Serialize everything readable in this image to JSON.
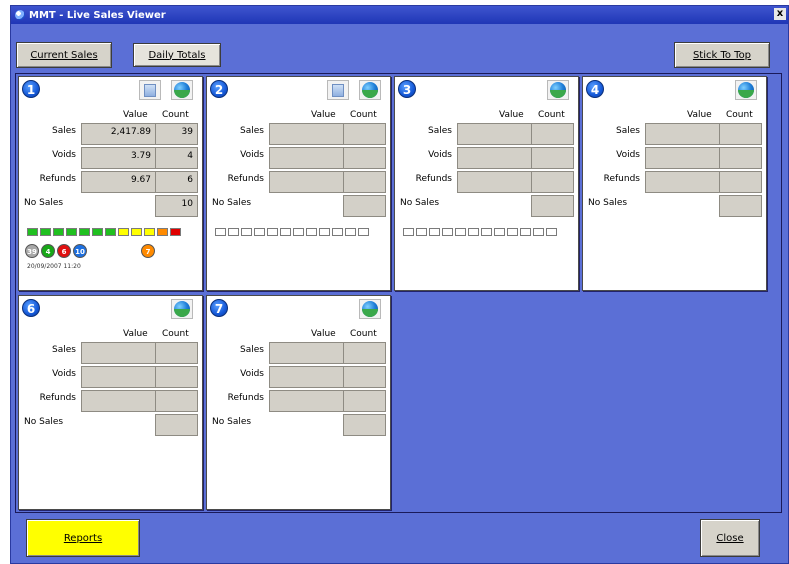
{
  "window": {
    "title": "MMT - Live Sales Viewer",
    "close_glyph": "x"
  },
  "toolbar": {
    "current_sales": "Current Sales",
    "daily_totals": "Daily Totals",
    "stick_to_top": "Stick To Top"
  },
  "footer": {
    "reports": "Reports",
    "close": "Close"
  },
  "table_headers": {
    "value": "Value",
    "count": "Count"
  },
  "row_labels": {
    "sales": "Sales",
    "voids": "Voids",
    "refunds": "Refunds",
    "no_sales": "No Sales"
  },
  "panels": [
    {
      "number": "1",
      "sales_value": "2,417.89",
      "sales_count": "39",
      "voids_value": "3.79",
      "voids_count": "4",
      "refunds_value": "9.67",
      "refunds_count": "6",
      "no_sales_count": "10",
      "has_doc_icon": true
    },
    {
      "number": "2",
      "has_doc_icon": true
    },
    {
      "number": "3",
      "has_doc_icon": false
    },
    {
      "number": "4",
      "has_doc_icon": false
    },
    {
      "number": "6",
      "has_doc_icon": false
    },
    {
      "number": "7",
      "has_doc_icon": false
    }
  ],
  "panel1_status": {
    "led_colors": [
      "#20c020",
      "#20c020",
      "#20c020",
      "#20c020",
      "#20c020",
      "#20c020",
      "#20c020",
      "#ffff00",
      "#ffff00",
      "#ffff00",
      "#ff8a00",
      "#e00000"
    ],
    "circles": [
      {
        "label": "39",
        "color": "#a8a8a8"
      },
      {
        "label": "4",
        "color": "#18a818"
      },
      {
        "label": "6",
        "color": "#e01010"
      },
      {
        "label": "10",
        "color": "#1e70e0"
      },
      {
        "label": "7",
        "color": "#ff8a00"
      }
    ],
    "timestamp": "20/09/2007 11:20"
  },
  "colors": {
    "background": "#5b6fd6",
    "reports_button": "#ffff00"
  }
}
